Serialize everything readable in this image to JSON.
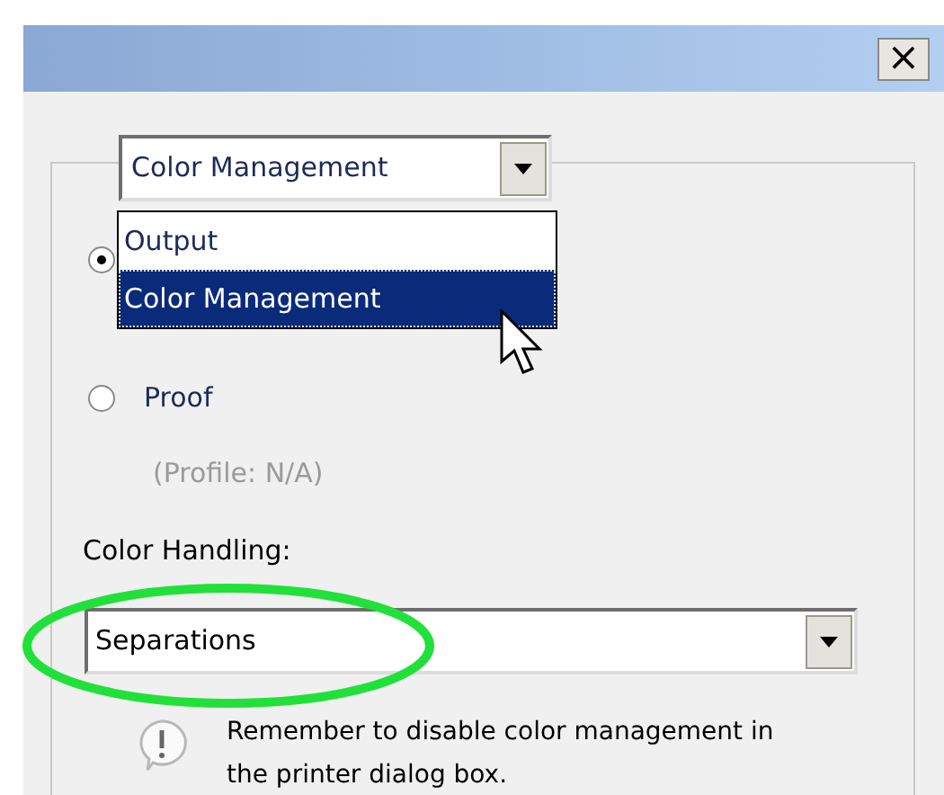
{
  "window": {
    "close_label": "×"
  },
  "group": {
    "selector": {
      "value": "Color Management",
      "open": true,
      "options": [
        {
          "label": "Output",
          "selected": false
        },
        {
          "label": "Color Management",
          "selected": true
        }
      ]
    },
    "radios": [
      {
        "selected": true
      },
      {
        "label": "Proof",
        "selected": false,
        "profile": "(Profile: N/A)"
      }
    ],
    "color_handling": {
      "label": "Color Handling:",
      "value": "Separations",
      "highlighted": true
    },
    "note": "Remember to disable color management in the printer dialog box."
  }
}
